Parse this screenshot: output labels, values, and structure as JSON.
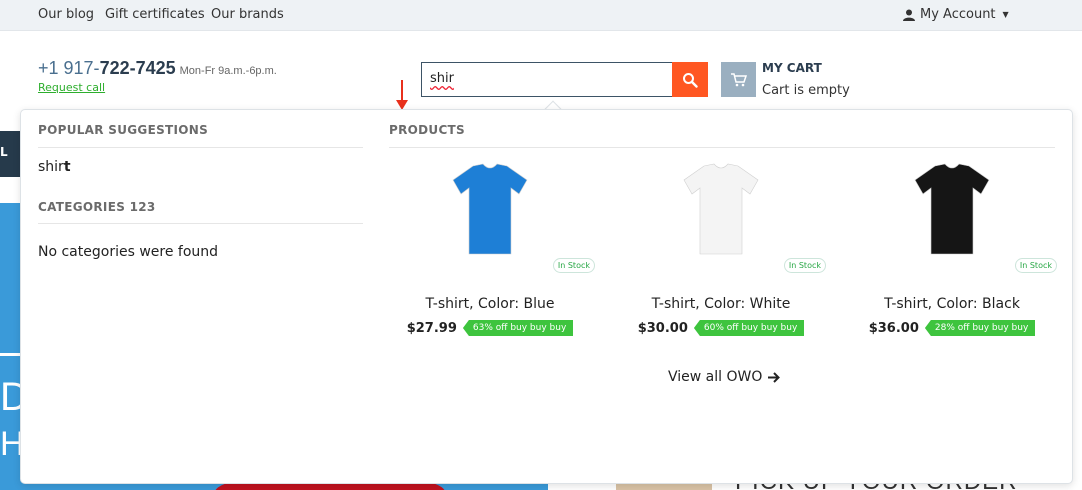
{
  "topbar": {
    "links": [
      "Our blog",
      "Gift certificates",
      "Our brands"
    ],
    "account_label": "My Account"
  },
  "header": {
    "phone_prefix": "+1 917-",
    "phone_main": "722-7425",
    "phone_hours": "Mon-Fr 9a.m.-6p.m.",
    "request_call": "Request call",
    "search_value": "shir",
    "cart_title": "MY CART",
    "cart_status": "Cart is empty"
  },
  "background": {
    "side_letter": "L",
    "banner_letter_1": "D",
    "banner_letter_2": "H",
    "pickup_text": "PICK UP YOUR ORDER"
  },
  "dropdown": {
    "popular_title": "POPULAR SUGGESTIONS",
    "suggestion_typed": "shir",
    "suggestion_completion": "t",
    "categories_title": "CATEGORIES 123",
    "categories_empty": "No categories were found",
    "products_title": "PRODUCTS",
    "products": [
      {
        "name": "T-shirt, Color: Blue",
        "price": "$27.99",
        "badge": "63% off buy buy buy",
        "stock": "In Stock",
        "shirt_color": "#1e7fd6"
      },
      {
        "name": "T-shirt, Color: White",
        "price": "$30.00",
        "badge": "60% off buy buy buy",
        "stock": "In Stock",
        "shirt_color": "#f4f4f4"
      },
      {
        "name": "T-shirt, Color: Black",
        "price": "$36.00",
        "badge": "28% off buy buy buy",
        "stock": "In Stock",
        "shirt_color": "#151515"
      }
    ],
    "view_all": "View all OWO"
  },
  "colors": {
    "search_button": "#ff5722",
    "badge_green": "#3ec43e",
    "phone_blue": "#4a6f8f",
    "request_green": "#2dae2d"
  }
}
